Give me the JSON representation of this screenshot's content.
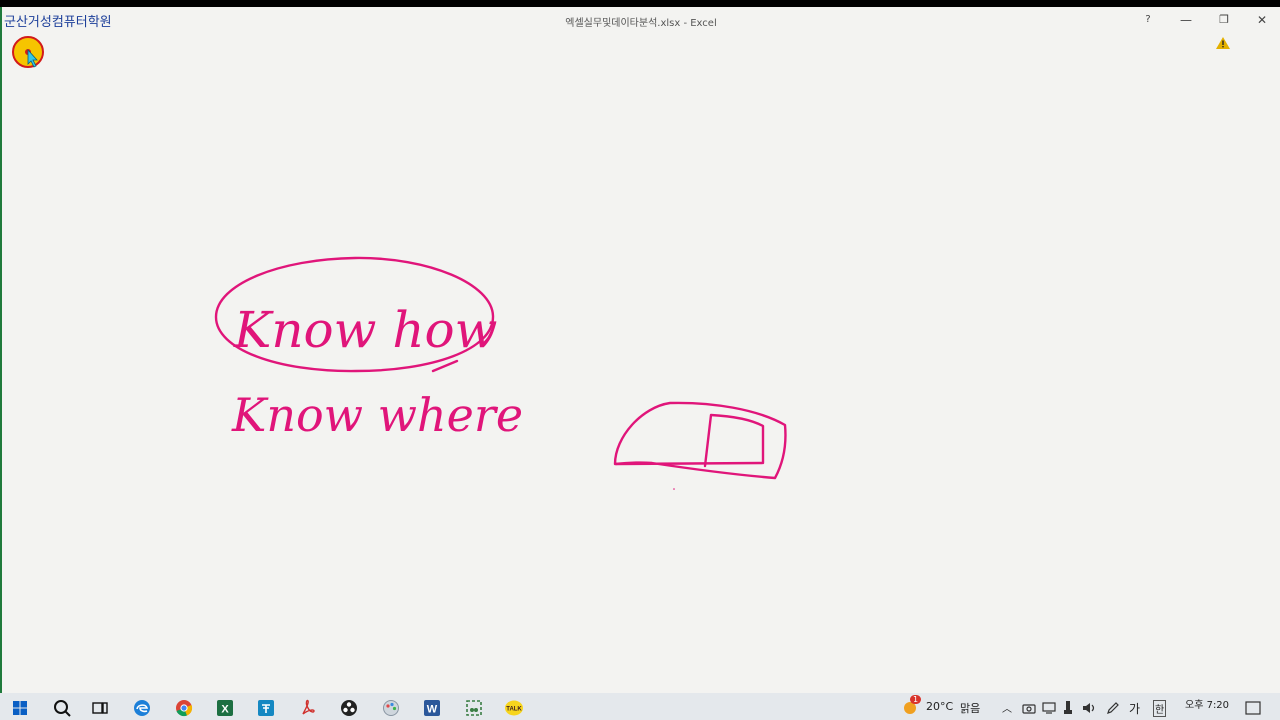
{
  "window": {
    "watermark": "군산거성컴퓨터학원",
    "title": "엑셀실무및데이타분석.xlsx - Excel",
    "help_label": "?",
    "minimize_label": "—",
    "restore_label": "❐",
    "close_label": "✕"
  },
  "whiteboard": {
    "ink_color": "#e0157a",
    "line1": "Know how",
    "line2": "Know where"
  },
  "taskbar": {
    "apps": [
      {
        "name": "start-button",
        "icon": "windows-logo-icon",
        "color": "#0a5fc4"
      },
      {
        "name": "search-button",
        "icon": "search-icon",
        "color": "#111111"
      },
      {
        "name": "task-view-button",
        "icon": "task-view-icon",
        "color": "#111111"
      },
      {
        "name": "edge-app",
        "icon": "edge-icon",
        "color": "#1c7fd8"
      },
      {
        "name": "chrome-app",
        "icon": "chrome-icon",
        "color": "#db4437"
      },
      {
        "name": "excel-app",
        "icon": "excel-icon",
        "color": "#1d6f42"
      },
      {
        "name": "store-app",
        "icon": "store-icon",
        "color": "#1588c2"
      },
      {
        "name": "pdf-app",
        "icon": "pdf-icon",
        "color": "#d0312d"
      },
      {
        "name": "obs-app",
        "icon": "obs-icon",
        "color": "#222222"
      },
      {
        "name": "paint-app",
        "icon": "paint-icon",
        "color": "#9aa5b1"
      },
      {
        "name": "word-app",
        "icon": "word-icon",
        "color": "#2b579a"
      },
      {
        "name": "snip-app",
        "icon": "snip-icon",
        "color": "#3a7d44"
      },
      {
        "name": "kakaotalk-app",
        "icon": "kakaotalk-icon",
        "color": "#f7d51d"
      }
    ],
    "weather_temp": "20°C",
    "weather_desc": "맑음",
    "ime_label": "가",
    "ime_mode": "한",
    "clock": "오후 7:20",
    "notification_badge": "1"
  }
}
